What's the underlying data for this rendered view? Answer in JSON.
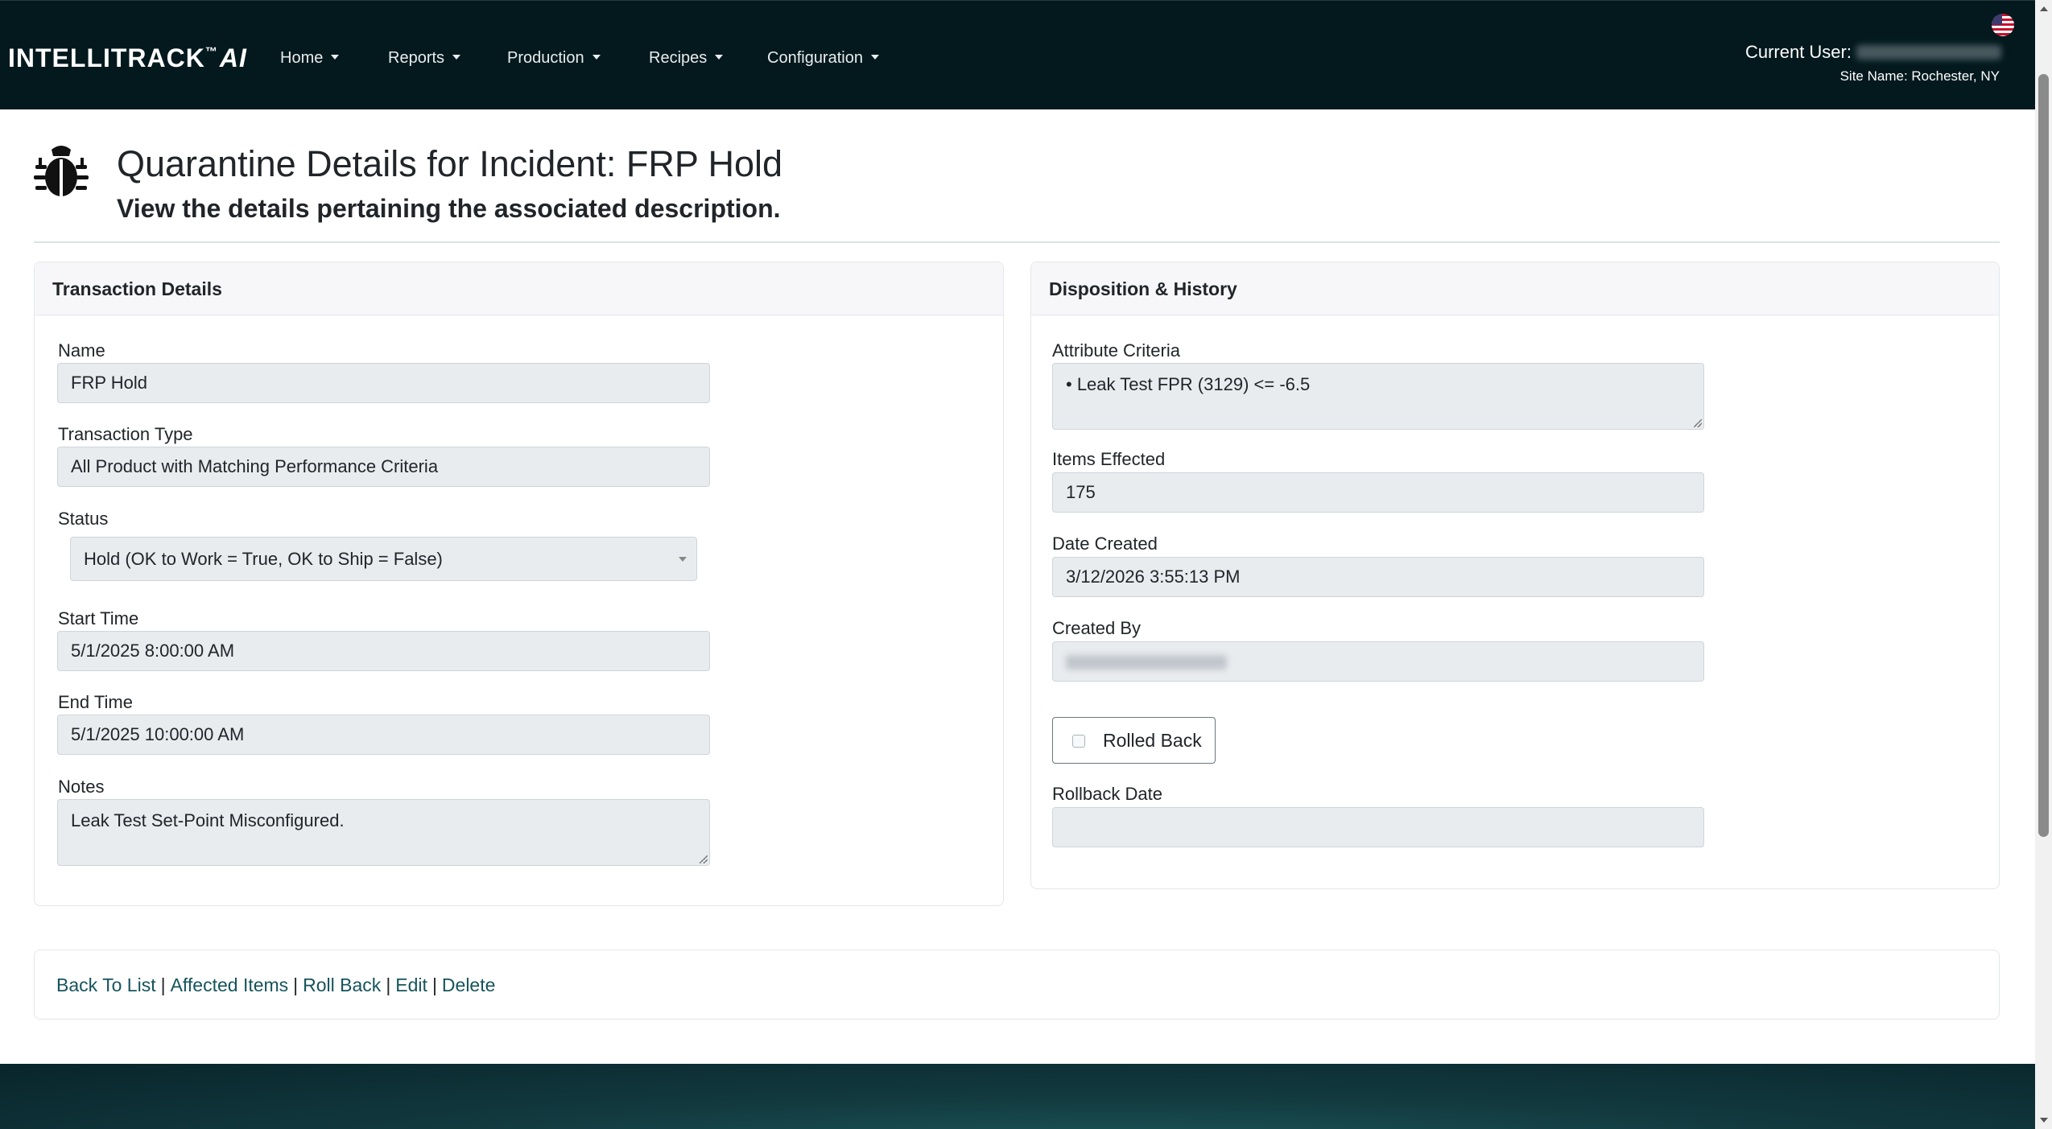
{
  "navbar": {
    "brand": {
      "main": "INTELLITRACK",
      "tm": "™",
      "ai": "AI"
    },
    "menu": [
      {
        "label": "Home"
      },
      {
        "label": "Reports"
      },
      {
        "label": "Production"
      },
      {
        "label": "Recipes"
      },
      {
        "label": "Configuration"
      }
    ],
    "current_user_label": "Current User:",
    "site_name": "Site Name: Rochester, NY"
  },
  "header": {
    "title": "Quarantine Details for Incident: FRP Hold",
    "subtitle": "View the details pertaining the associated description."
  },
  "transaction_details": {
    "title": "Transaction Details",
    "name_label": "Name",
    "name_value": "FRP Hold",
    "type_label": "Transaction Type",
    "type_value": "All Product with Matching Performance Criteria",
    "status_label": "Status",
    "status_value": "Hold (OK to Work = True, OK to Ship = False)",
    "start_label": "Start Time",
    "start_value": "5/1/2025 8:00:00 AM",
    "end_label": "End Time",
    "end_value": "5/1/2025 10:00:00 AM",
    "notes_label": "Notes",
    "notes_value": "Leak Test Set-Point Misconfigured."
  },
  "disposition": {
    "title": "Disposition & History",
    "criteria_label": "Attribute Criteria",
    "criteria_value": "• Leak Test FPR (3129) <= -6.5",
    "items_label": "Items Effected",
    "items_value": "175",
    "date_label": "Date Created",
    "date_value": "3/12/2026 3:55:13 PM",
    "created_by_label": "Created By",
    "rolled_back_label": "Rolled Back",
    "rolled_back_checked": false,
    "rollback_date_label": "Rollback Date",
    "rollback_date_value": ""
  },
  "actions": {
    "back": "Back To List",
    "affected": "Affected Items",
    "rollback": "Roll Back",
    "edit": "Edit",
    "delete": "Delete",
    "separator": "|"
  }
}
